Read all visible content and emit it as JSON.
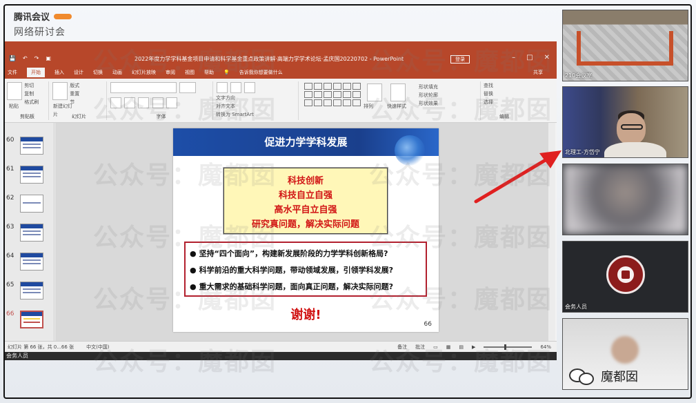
{
  "brand": {
    "line1": "腾讯会议",
    "line2": "网络研讨会"
  },
  "ppt": {
    "doc_title": "2022年度力学学科基金项目申请和科学基金重点政策讲解·高端力学学术论坛·孟庆国20220702 - PowerPoint",
    "login": "登录",
    "tabs": [
      "文件",
      "开始",
      "插入",
      "设计",
      "切换",
      "动画",
      "幻灯片放映",
      "审阅",
      "视图",
      "帮助"
    ],
    "search": "告诉我你想要做什么",
    "share": "共享",
    "ribbon": {
      "clipboard_label": "剪贴板",
      "paste": "粘贴",
      "cut": "剪切",
      "copy": "复制",
      "format_painter": "格式刷",
      "new_slide": "新建幻灯片",
      "layout": "版式",
      "reset": "重置",
      "section": "节",
      "slides_label": "幻灯片",
      "font_label": "字体",
      "text_direction": "文字方向",
      "align_text": "对齐文本",
      "smartart": "转换为 SmartArt",
      "arrange": "排列",
      "quick_styles": "快速样式",
      "shape_fill": "形状填充",
      "shape_outline": "形状轮廓",
      "shape_effects": "形状效果",
      "find": "查找",
      "replace": "替换",
      "select": "选择",
      "editing_label": "编辑"
    },
    "thumbs": [
      {
        "num": "60"
      },
      {
        "num": "61"
      },
      {
        "num": "62"
      },
      {
        "num": "63"
      },
      {
        "num": "64"
      },
      {
        "num": "65"
      },
      {
        "num": "66"
      }
    ],
    "slide": {
      "title": "促进力学学科发展",
      "yellow_lines": [
        "科技创新",
        "科技自立自强",
        "高水平自立自强",
        "研究真问题，解决实际问题"
      ],
      "bullets": [
        "坚持“四个面向”，构建新发展阶段的力学学科创新格局?",
        "科学前沿的重大科学问题，带动领域发展，引领学科发展?",
        "重大需求的基础科学问题，面向真正问题，解决实际问题?"
      ],
      "thanks": "谢谢!",
      "number": "66"
    },
    "status": {
      "slide_count": "幻灯片 第 66 张，共 0...66 张",
      "language": "中文(中国)",
      "notes": "备注",
      "comments": "批注",
      "zoom": "64%"
    }
  },
  "meeting_bar": "会务人员",
  "tiles": [
    {
      "label": "210会议室"
    },
    {
      "label": "北理工-方岱宁"
    },
    {
      "label": ""
    },
    {
      "label": "会务人员"
    },
    {
      "label": ""
    }
  ],
  "watermark": "公众号：魔都囡",
  "badge": "魔都囡",
  "colors": {
    "ppt_accent": "#b7472a",
    "slide_header": "#1d4ea8",
    "emphasis_red": "#d11414",
    "arrow": "#e02020"
  }
}
